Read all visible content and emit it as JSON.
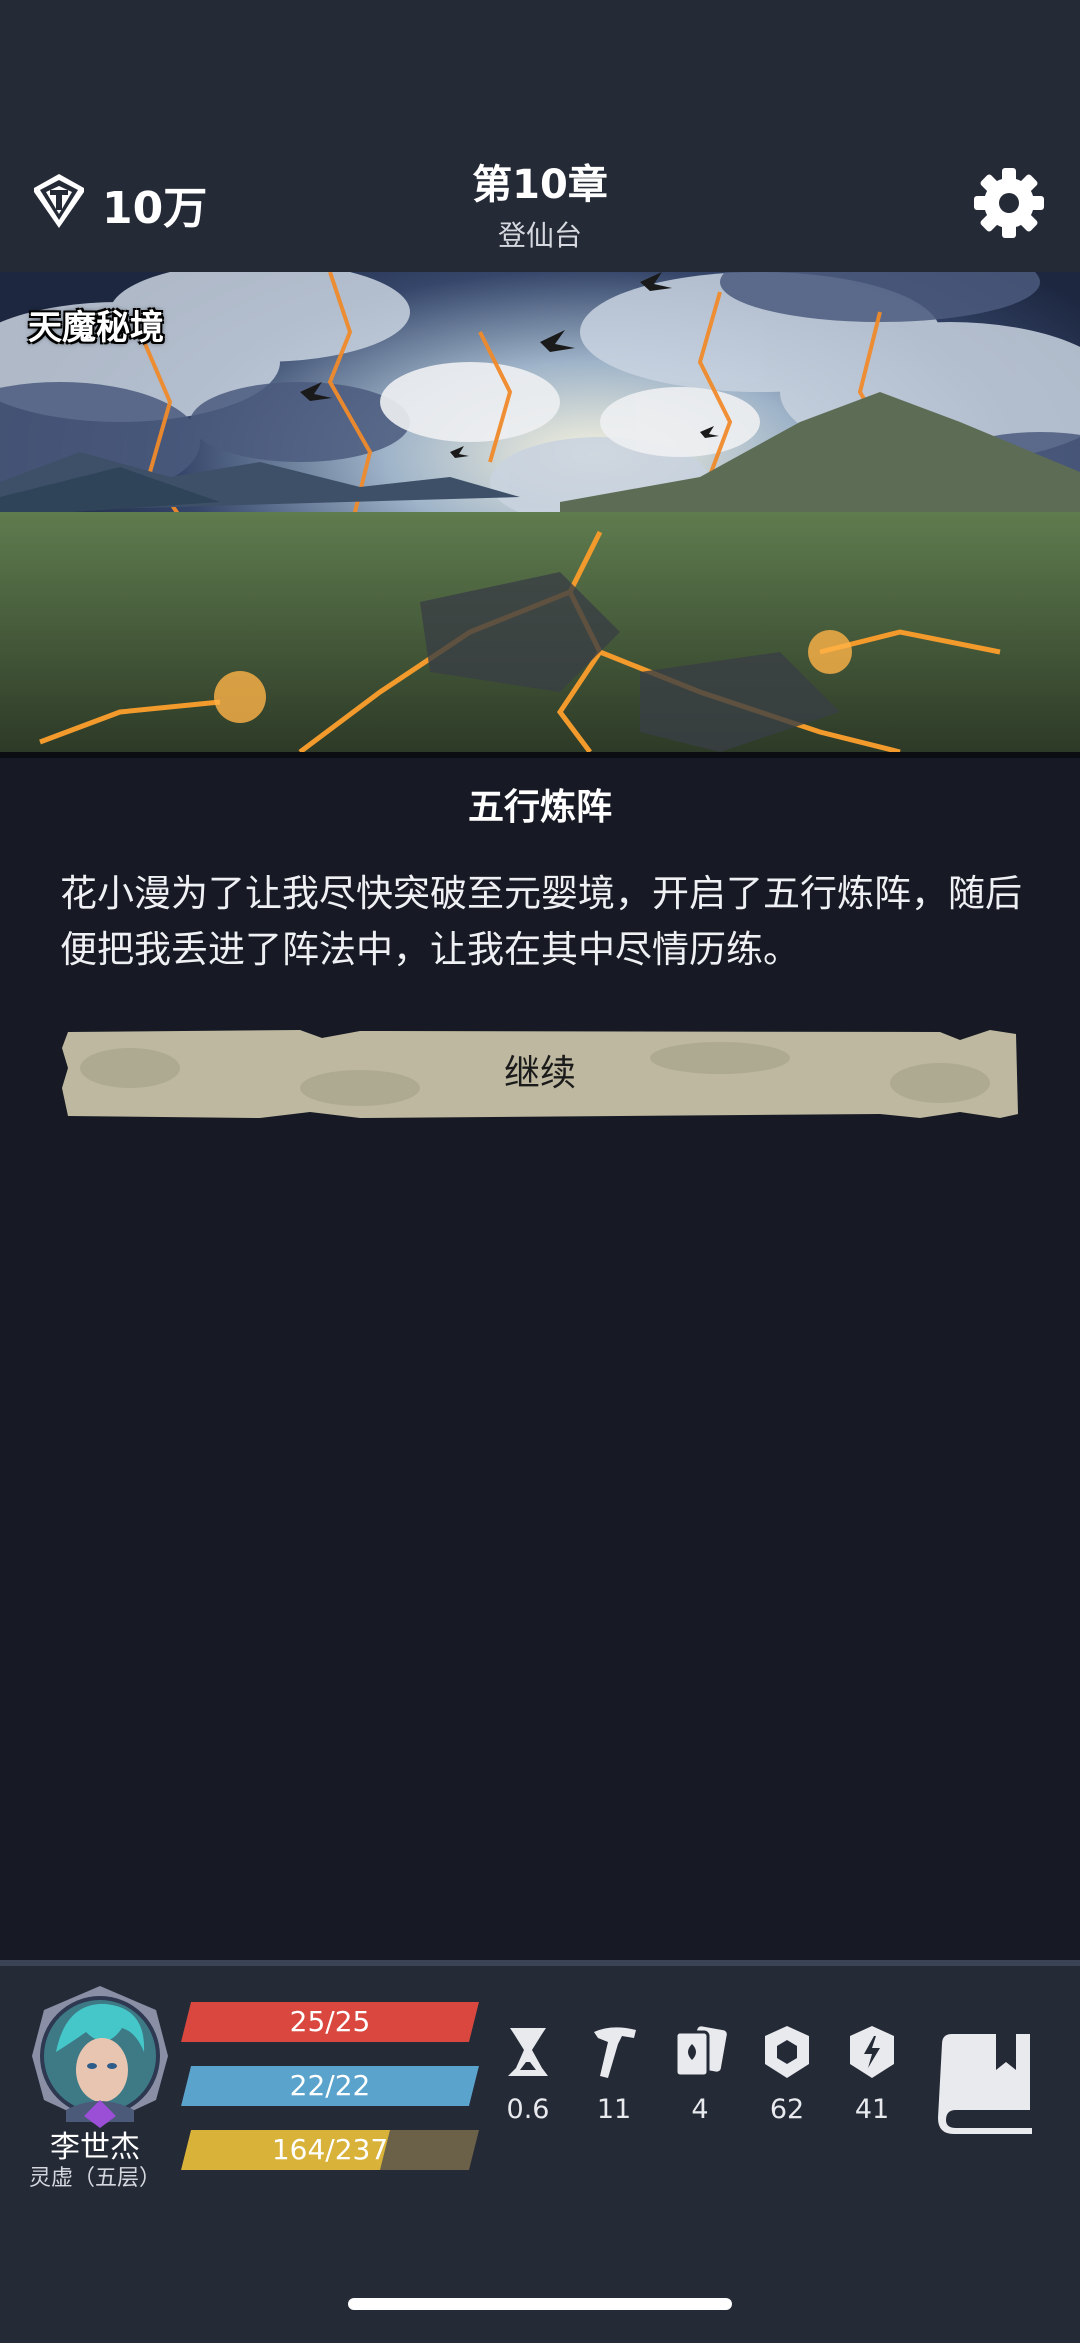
{
  "header": {
    "currency_value": "10万",
    "chapter_title": "第10章",
    "location_name": "登仙台",
    "icons": {
      "currency": "diamond-icon",
      "settings": "gear-icon"
    }
  },
  "scene": {
    "title": "天魔秘境"
  },
  "event": {
    "title": "五行炼阵",
    "description": "花小漫为了让我尽快突破至元婴境，开启了五行炼阵，随后便把我丢进了阵法中，让我在其中尽情历练。",
    "continue_label": "继续"
  },
  "player": {
    "name": "李世杰",
    "realm": "灵虚（五层）",
    "hp": {
      "text": "25/25",
      "fraction": 1.0,
      "color": "#d9473f"
    },
    "mp": {
      "text": "22/22",
      "fraction": 1.0,
      "color": "#5aa3cc"
    },
    "exp": {
      "text": "164/237",
      "fraction": 0.69,
      "color": "#d9b23a"
    }
  },
  "stats": [
    {
      "icon": "hourglass-icon",
      "value": "0.6"
    },
    {
      "icon": "hammer-icon",
      "value": "11"
    },
    {
      "icon": "cards-icon",
      "value": "4"
    },
    {
      "icon": "shield-icon",
      "value": "62"
    },
    {
      "icon": "lightning-shield-icon",
      "value": "41"
    }
  ],
  "colors": {
    "background": "#171a24",
    "panel": "#252a37",
    "button_parchment": "#bdb89f"
  }
}
